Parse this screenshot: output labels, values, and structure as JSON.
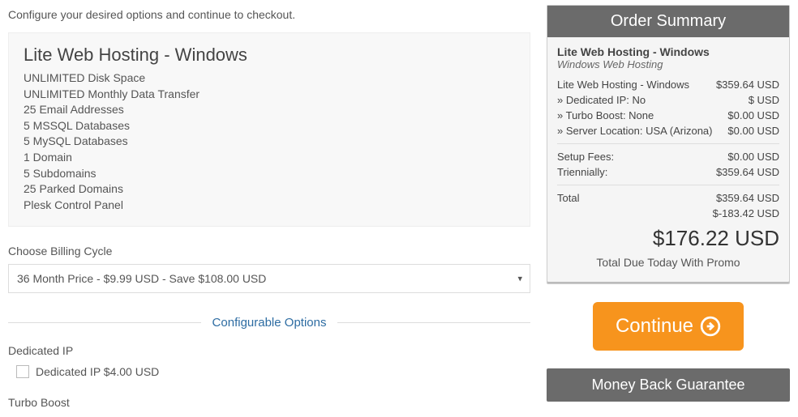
{
  "intro": "Configure your desired options and continue to checkout.",
  "product": {
    "title": "Lite Web Hosting - Windows",
    "features": [
      "UNLIMITED Disk Space",
      "UNLIMITED Monthly Data Transfer",
      "25 Email Addresses",
      "5 MSSQL Databases",
      "5 MySQL Databases",
      "1 Domain",
      "5 Subdomains",
      "25 Parked Domains",
      "Plesk Control Panel"
    ]
  },
  "billing": {
    "label": "Choose Billing Cycle",
    "selected": "36 Month Price - $9.99 USD - Save $108.00 USD"
  },
  "configurable": {
    "heading": "Configurable Options",
    "dedicated_ip": {
      "label": "Dedicated IP",
      "option": "Dedicated IP $4.00 USD"
    },
    "turbo": {
      "label": "Turbo Boost"
    }
  },
  "summary": {
    "header": "Order Summary",
    "title": "Lite Web Hosting - Windows",
    "subtitle": "Windows Web Hosting",
    "lines": [
      {
        "label": "Lite Web Hosting - Windows",
        "value": "$359.64 USD"
      },
      {
        "label": "» Dedicated IP: No",
        "value": "$ USD"
      },
      {
        "label": "» Turbo Boost: None",
        "value": "$0.00 USD"
      },
      {
        "label": "» Server Location: USA (Arizona)",
        "value": "$0.00 USD"
      }
    ],
    "fees": [
      {
        "label": "Setup Fees:",
        "value": "$0.00 USD"
      },
      {
        "label": "Triennially:",
        "value": "$359.64 USD"
      }
    ],
    "total_label": "Total",
    "total_value": "$359.64 USD",
    "discount": "$-183.42 USD",
    "grand_total": "$176.22 USD",
    "due_label": "Total Due Today With Promo"
  },
  "continue_label": "Continue",
  "guarantee_header": "Money Back Guarantee"
}
